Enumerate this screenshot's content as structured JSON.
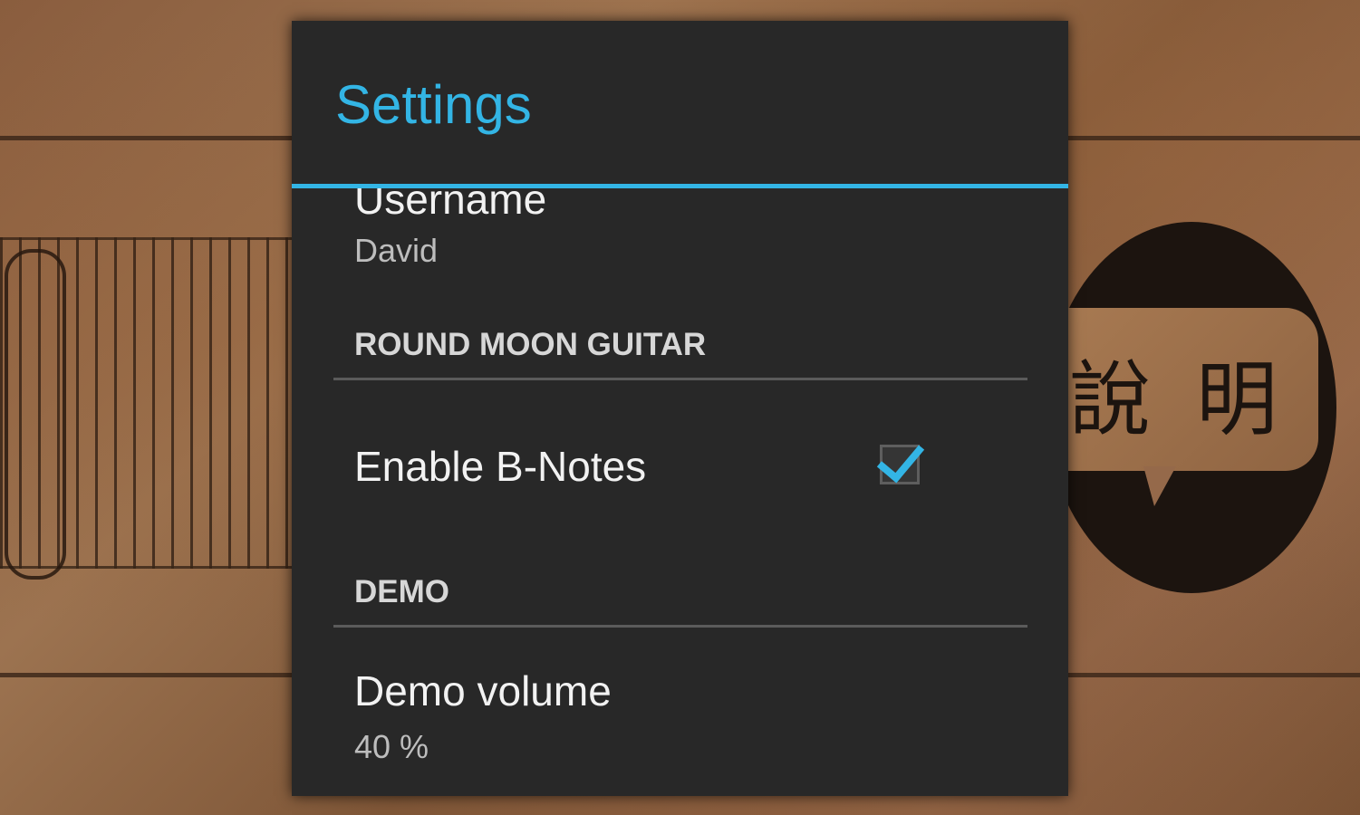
{
  "dialog": {
    "title": "Settings"
  },
  "preferences": {
    "username": {
      "title": "Username",
      "summary": "David"
    },
    "categories": [
      {
        "label": "ROUND MOON GUITAR"
      },
      {
        "label": "DEMO"
      }
    ],
    "enable_b_notes": {
      "title": "Enable B-Notes",
      "checked": true
    },
    "demo_volume": {
      "title": "Demo volume",
      "summary": "40 %"
    }
  },
  "background": {
    "help_glyphs": "說明"
  },
  "colors": {
    "accent": "#33b5e5",
    "dialog_background": "#282828",
    "primary_text": "#f2f2f2",
    "secondary_text": "#bdbdbd"
  },
  "icons": {
    "checkbox": "checkmark-icon"
  }
}
